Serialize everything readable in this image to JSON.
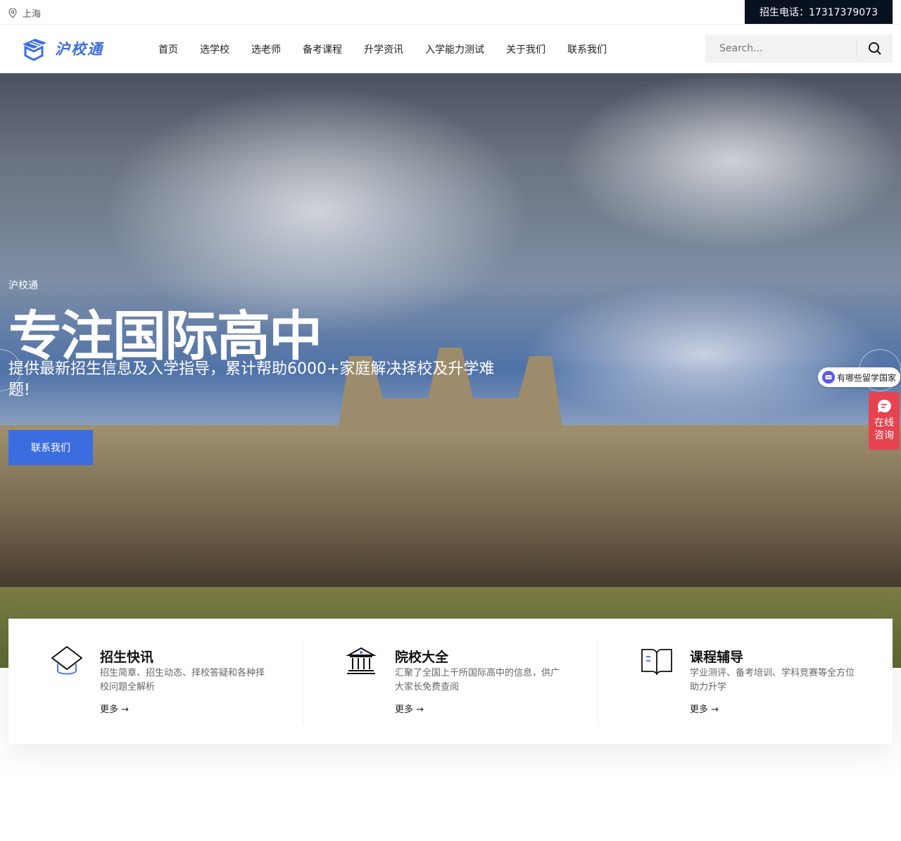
{
  "topbar": {
    "location": "上海",
    "phone": "招生电话：17317379073"
  },
  "header": {
    "logo_text": "沪校通",
    "nav": [
      "首页",
      "选学校",
      "选老师",
      "备考课程",
      "升学资讯",
      "入学能力测试",
      "关于我们",
      "联系我们"
    ],
    "search_placeholder": "Search..."
  },
  "hero": {
    "subtitle": "沪校通",
    "title": "专注国际高中",
    "description": "提供最新招生信息及入学指导，累计帮助6000+家庭解决择校及升学难题!",
    "button": "联系我们"
  },
  "widgets": {
    "question": "有哪些留学国家",
    "consult_line1": "在线",
    "consult_line2": "咨询"
  },
  "cards": [
    {
      "title": "招生快讯",
      "desc": "招生简章、招生动态、择校答疑和各种择校问题全解析",
      "more": "更多 →",
      "icon": "graduation-cap-icon"
    },
    {
      "title": "院校大全",
      "desc": "汇聚了全国上千所国际高中的信息，供广大家长免费查阅",
      "more": "更多 →",
      "icon": "school-building-icon"
    },
    {
      "title": "课程辅导",
      "desc": "学业测评、备考培训、学科竞赛等全方位助力升学",
      "more": "更多 →",
      "icon": "book-icon"
    }
  ],
  "colors": {
    "accent": "#3b6de0",
    "phone_bg": "#07111f",
    "consult": "#e6434f"
  }
}
